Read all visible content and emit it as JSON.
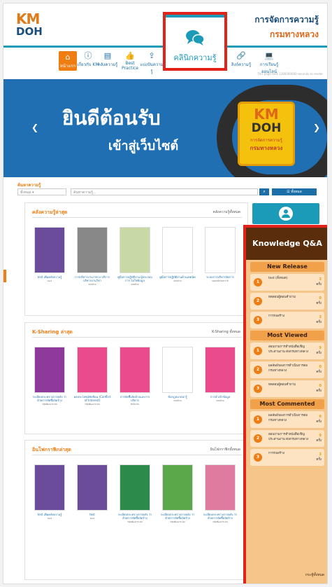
{
  "header": {
    "logo_top": "KM",
    "logo_bottom": "DOH",
    "brand_line1": "การจัดการความรู้",
    "brand_line2": "กรมทางหลวง"
  },
  "clinic": {
    "label": "คลินิกความรู้",
    "icon": "chat-bubbles-icon"
  },
  "nav": {
    "items": [
      {
        "label": "หน้าแรก",
        "icon": "home-icon"
      },
      {
        "label": "เกี่ยวกับ KM",
        "icon": "info-icon"
      },
      {
        "label": "คลังความรู้",
        "icon": "book-icon"
      },
      {
        "label": "Best Practice",
        "icon": "thumbs-up-icon"
      },
      {
        "label": "แบ่งปันความรู้",
        "icon": "share-icon"
      },
      {
        "label": "ลิงก์ความรู้",
        "icon": "link-icon"
      },
      {
        "label": "การเรียนรู้ออนไลน์",
        "icon": "laptop-icon"
      }
    ],
    "note": "This page took 1280000000 seconds to render"
  },
  "banner": {
    "title": "ยินดีต้อนรับ",
    "subtitle": "เข้าสู่เว็บไซต์",
    "badge_km": "KM",
    "badge_doh": "DOH",
    "badge_line1": "การจัดการความรู้",
    "badge_line2": "กรมทางหลวง"
  },
  "search": {
    "heading": "ค้นหาความรู้",
    "select_value": "ทั้งหมด",
    "placeholder": "ค้นหาความรู้...",
    "button_icon": "search-icon",
    "advanced_label": "ทั้งหมด"
  },
  "sections": [
    {
      "title": "คลังความรู้ล่าสุด",
      "more": "คลังความรู้ทั้งหมด",
      "cards": [
        {
          "title": "test เพิ่มคลังความรู้",
          "sub": "test",
          "color": "#6b4c9a"
        },
        {
          "title": "การบริหารงานวาทาง บริการบริหารงานวิชา",
          "sub": "ครบถ้วน",
          "color": "#888"
        },
        {
          "title": "คู่มือการปฏิบัติงาน ผู้ประกอบการ ไม่ใช่ข้อมูล",
          "sub": "ครบถ้วน",
          "color": "#c8d9a5"
        },
        {
          "title": "คู่มือการปฏิบัติงานด้านเทคนิค",
          "sub": "ครบถ้วน",
          "color": "#fff"
        },
        {
          "title": "ระบบการบริหารจัดการ",
          "sub": "แผนกนักวิเคราะห์",
          "color": "#fff"
        }
      ]
    },
    {
      "title": "K-Sharing ล่าสุด",
      "more": "K-Sharing ทั้งหมด",
      "cards": [
        {
          "title": "ระเบียบกระทรวงการคลัง ว่าด้วยการจัดซื้อจัดจ้าง",
          "sub": "กลุ่มพัฒนาระบบ",
          "color": "#8e3a9a"
        },
        {
          "title": "ผลประโยชน์ทับซ้อน (Conflict of Interest)",
          "sub": "กลุ่มพัฒนาระบบ",
          "color": "#e94b8c"
        },
        {
          "title": "การจัดซื้อจัดจ้างและการบริหาร",
          "sub": "สำนักงาน",
          "color": "#e94b8c"
        },
        {
          "title": "ข้อกฎหมายน่ารู้",
          "sub": "ครบถ้วน",
          "color": "#fff"
        },
        {
          "title": "การนำเข้าข้อมูล",
          "sub": "ครบถ้วน",
          "color": "#e94b8c"
        }
      ]
    },
    {
      "title": "อินโฟกราฟิกล่าสุด",
      "more": "อินโฟกราฟิกทั้งหมด",
      "cards": [
        {
          "title": "test เพิ่มคลังความรู้",
          "sub": "test",
          "color": "#6b4c9a"
        },
        {
          "title": "test",
          "sub": "test",
          "color": "#6b4c9a"
        },
        {
          "title": "ระเบียบกระทรวงการคลัง ว่าด้วยการจัดซื้อจัดจ้าง",
          "sub": "กลุ่มพัฒนาระบบ",
          "color": "#2c8a4a"
        },
        {
          "title": "ระเบียบกระทรวงการคลัง ว่าด้วยการจัดซื้อจัดจ้าง",
          "sub": "กลุ่มพัฒนาระบบ",
          "color": "#5aa84a"
        },
        {
          "title": "ระเบียบกระทรวงการคลัง ว่าด้วยการจัดซื้อจัดจ้าง",
          "sub": "กลุ่มพัฒนาระบบ",
          "color": "#e07ba0"
        }
      ]
    }
  ],
  "profile": {
    "icon": "user-icon"
  },
  "qa": {
    "title": "Knowledge Q&A",
    "unit": "ครั้ง",
    "groups": [
      {
        "heading": "New Release",
        "items": [
          {
            "n": "1",
            "text": "test (ทั้งหมด)",
            "count": "3"
          },
          {
            "n": "2",
            "text": "ทดสอบผู้ตอบคำถาม",
            "count": "0"
          },
          {
            "n": "3",
            "text": "การก่อสร้าง",
            "count": "3"
          }
        ]
      },
      {
        "heading": "Most Viewed",
        "items": [
          {
            "n": "1",
            "text": "สอบถามการทำหนังสือเชิญ ประสานงาน ต่อกรมทางหลวง",
            "count": "9"
          },
          {
            "n": "2",
            "text": "ผลลัพธ์ของการดำเนินการต่อกรมทางหลวง",
            "count": "0"
          },
          {
            "n": "3",
            "text": "ทดสอบผู้ตอบคำถาม",
            "count": "0"
          }
        ]
      },
      {
        "heading": "Most Commented",
        "items": [
          {
            "n": "1",
            "text": "ผลลัพธ์ของการดำเนินการต่อกรมทางหลวง",
            "count": "0"
          },
          {
            "n": "2",
            "text": "สอบถามการทำหนังสือเชิญ ประสานงาน ต่อกรมทางหลวง",
            "count": "9"
          },
          {
            "n": "3",
            "text": "การก่อสร้าง",
            "count": "3"
          }
        ]
      }
    ],
    "more": "กระทู้ทั้งหมด"
  }
}
